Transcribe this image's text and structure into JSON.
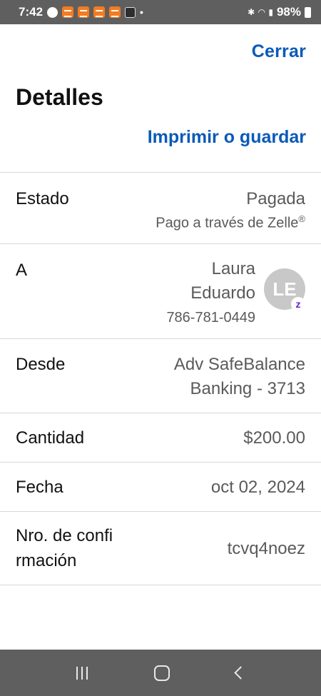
{
  "status_bar": {
    "time": "7:42",
    "battery": "98%"
  },
  "header": {
    "close_label": "Cerrar",
    "title": "Detalles",
    "print_label": "Imprimir o guardar"
  },
  "rows": {
    "status": {
      "label": "Estado",
      "value": "Pagada",
      "sub": "Pago a través de Zelle",
      "sub_mark": "®"
    },
    "to": {
      "label": "A",
      "first_name": "Laura",
      "last_name": "Eduardo",
      "phone": "786-781-0449",
      "initials": "LE",
      "badge": "z"
    },
    "from": {
      "label": "Desde",
      "line1": "Adv SafeBalance",
      "line2": "Banking - 3713"
    },
    "amount": {
      "label": "Cantidad",
      "value": "$200.00"
    },
    "date": {
      "label": "Fecha",
      "value": "oct 02, 2024"
    },
    "confirmation": {
      "label_line1": "Nro. de confi",
      "label_line2": "rmación",
      "value": "tcvq4noez"
    }
  },
  "colors": {
    "link": "#0a5ab8",
    "system_bars": "#5f5f5f",
    "zelle_purple": "#6d1ed4"
  }
}
